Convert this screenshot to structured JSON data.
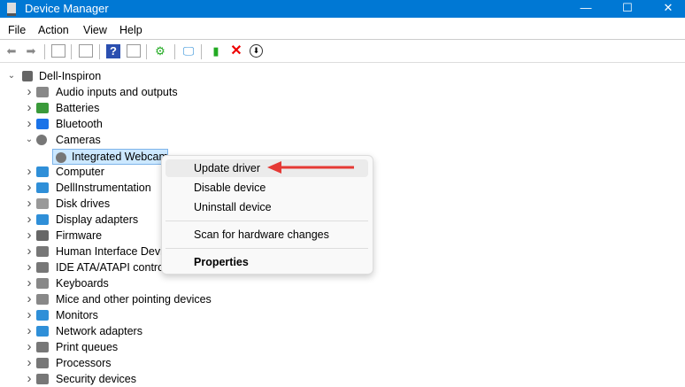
{
  "window": {
    "title": "Device Manager",
    "controls": [
      "—",
      "☐",
      "✕"
    ]
  },
  "menu": [
    "File",
    "Action",
    "View",
    "Help"
  ],
  "toolbar": [
    "back",
    "forward",
    "show-hide-console-tree",
    "properties",
    "help",
    "show-hide-action-pane",
    "update-driver",
    "scan-hardware",
    "enable-device",
    "uninstall",
    "disable"
  ],
  "tree": {
    "root": "Dell-Inspiron",
    "items": [
      {
        "label": "Audio inputs and outputs",
        "color": "#888"
      },
      {
        "label": "Batteries",
        "color": "#3a9a3a"
      },
      {
        "label": "Bluetooth",
        "color": "#1a73e8"
      },
      {
        "label": "Cameras",
        "color": "#777",
        "expanded": true
      },
      {
        "label": "Integrated Webcam",
        "child": true,
        "selected": true,
        "color": "#777"
      },
      {
        "label": "Computer",
        "color": "#2f8fd8"
      },
      {
        "label": "DellInstrumentation",
        "color": "#2f8fd8"
      },
      {
        "label": "Disk drives",
        "color": "#999"
      },
      {
        "label": "Display adapters",
        "color": "#2f8fd8"
      },
      {
        "label": "Firmware",
        "color": "#666"
      },
      {
        "label": "Human Interface Devices",
        "color": "#777"
      },
      {
        "label": "IDE ATA/ATAPI controllers",
        "color": "#777"
      },
      {
        "label": "Keyboards",
        "color": "#888"
      },
      {
        "label": "Mice and other pointing devices",
        "color": "#888"
      },
      {
        "label": "Monitors",
        "color": "#2f8fd8"
      },
      {
        "label": "Network adapters",
        "color": "#2f8fd8"
      },
      {
        "label": "Print queues",
        "color": "#777"
      },
      {
        "label": "Processors",
        "color": "#777"
      },
      {
        "label": "Security devices",
        "color": "#777"
      }
    ]
  },
  "context_menu": {
    "items": [
      "Update driver",
      "Disable device",
      "Uninstall device",
      "Scan for hardware changes",
      "Properties"
    ]
  },
  "colors": {
    "titlebar": "#0078d4",
    "arrow": "#e53935"
  }
}
